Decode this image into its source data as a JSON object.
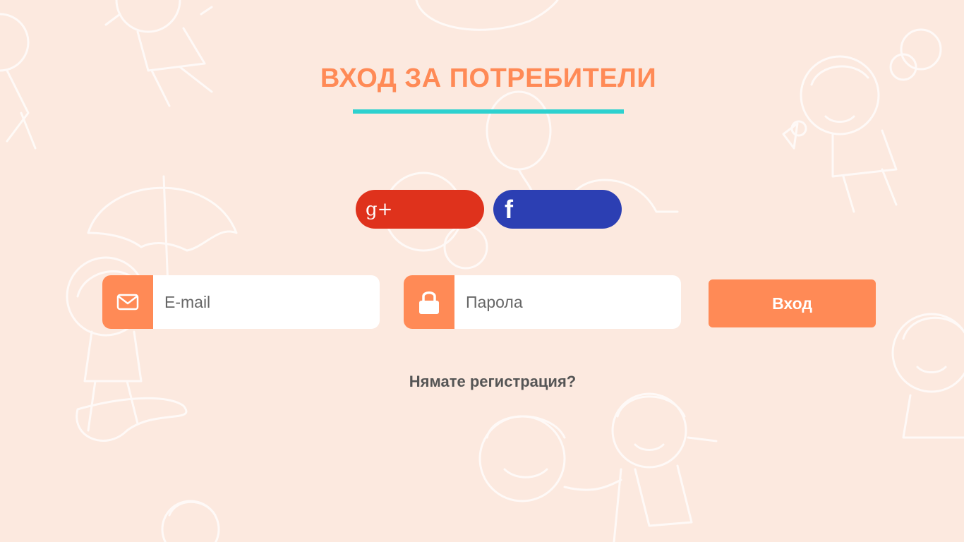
{
  "header": {
    "title": "ВХОД ЗА ПОТРЕБИТЕЛИ"
  },
  "social": {
    "google_icon": "google-plus-icon",
    "google_glyph": "g+",
    "facebook_icon": "facebook-icon",
    "facebook_glyph": "f"
  },
  "form": {
    "email": {
      "placeholder": "E-mail",
      "value": "",
      "icon": "envelope-icon"
    },
    "password": {
      "placeholder": "Парола",
      "value": "",
      "icon": "lock-icon"
    },
    "submit_label": "Вход"
  },
  "footer": {
    "register_link": "Нямате регистрация?"
  },
  "colors": {
    "background": "#fce9df",
    "accent": "#ff8a56",
    "underline": "#2ed1cf",
    "google": "#df321c",
    "facebook": "#2c3fb3",
    "text_dark": "#555555"
  }
}
